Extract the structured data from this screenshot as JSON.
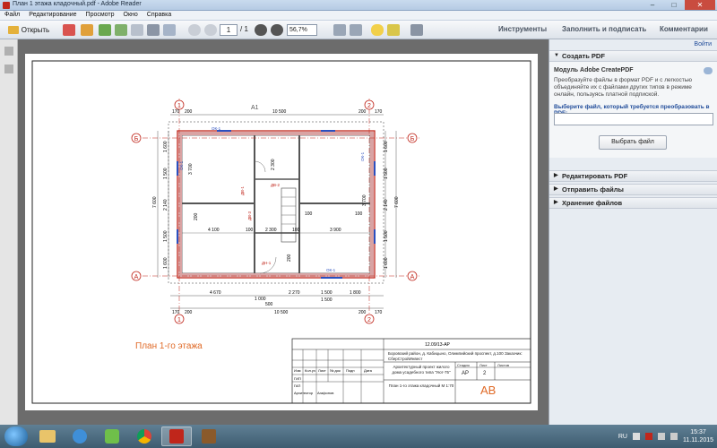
{
  "window": {
    "title": "План 1 этажа кладочный.pdf - Adobe Reader",
    "min": "–",
    "max": "□",
    "close": "✕"
  },
  "menu": [
    "Файл",
    "Редактирование",
    "Просмотр",
    "Окно",
    "Справка"
  ],
  "toolbar": {
    "open_label": "Открыть",
    "page_current": "1",
    "page_total": "/ 1",
    "zoom": "56,7%",
    "tools": "Инструменты",
    "fill_sign": "Заполнить и подписать",
    "comments": "Комментарии"
  },
  "panel": {
    "signin": "Войти",
    "create_pdf": "Создать PDF",
    "module_title": "Модуль Adobe CreatePDF",
    "module_desc": "Преобразуйте файлы в формат PDF и с легкостью объединяйте их с файлами других типов в режиме онлайн, пользуясь платной подпиской.",
    "select_label": "Выберите файл, который требуется преобразовать в PDF:",
    "select_button": "Выбрать файл",
    "edit_pdf": "Редактировать PDF",
    "send_files": "Отправить файлы",
    "storage": "Хранение файлов"
  },
  "drawing": {
    "plan_title": "План 1-го этажа",
    "axes": {
      "a": "А",
      "b": "Б",
      "one": "1",
      "two": "2"
    },
    "section_mark": "А1",
    "dims_top": [
      "170",
      "200",
      "10 500",
      "200",
      "170"
    ],
    "dims_bottom": [
      "170",
      "200",
      "10 500",
      "200",
      "170"
    ],
    "dims_bottom_inner": [
      "4 670",
      "2 270",
      "1 500",
      "1 800"
    ],
    "dims_bottom_small": [
      "1 000",
      "1 500",
      "500"
    ],
    "dims_mid": [
      "4 100",
      "100",
      "2 300",
      "100",
      "3 900"
    ],
    "dims_left_outer": "7 600",
    "dims_right_outer": "7 600",
    "dims_left": [
      "1 600",
      "1 500",
      "2 140",
      "1 500",
      "1 600"
    ],
    "dims_right": [
      "1 600",
      "1 500",
      "2 140",
      "1 500",
      "1 600"
    ],
    "room_dims_left": "3 700",
    "room_dims_right": "3 700",
    "small_labels": [
      "ДВ-1",
      "ДВ-2",
      "ДВ-3",
      "ДН-1",
      "ОК-1",
      "ОК-1",
      "ОК-1",
      "ОК-1",
      "100",
      "100",
      "200",
      "200",
      "2 300"
    ]
  },
  "stamp": {
    "code": "12.09/13-АР",
    "address": "Боровский район, д. Кабицыно, Олимпийский проспект, д.100  Заказчик: СберСтройИнвест",
    "project": "Архитектурный проект жилого дома усадебного типа \"Уют-75\"",
    "sheet_title": "План 1-го этажа кладочный М 1:70",
    "stage_h": "Стадия",
    "sheet_h": "Лист",
    "sheets_h": "Листов",
    "stage": "АР",
    "sheet": "2",
    "sheets": "",
    "rows": [
      "ГИП",
      "ГАП",
      "Архитектор"
    ],
    "cols": [
      "Изм",
      "Кол.уч",
      "Лист",
      "№ док",
      "Подп",
      "Дата"
    ],
    "architect": "Агафонов",
    "logo": "АВ"
  },
  "taskbar": {
    "lang": "RU",
    "time": "15:37",
    "date": "11.11.2015"
  },
  "colors": {
    "accent_red": "#c0261b",
    "plan_orange": "#e06a27",
    "wall_hatch": "#c88a8a"
  }
}
